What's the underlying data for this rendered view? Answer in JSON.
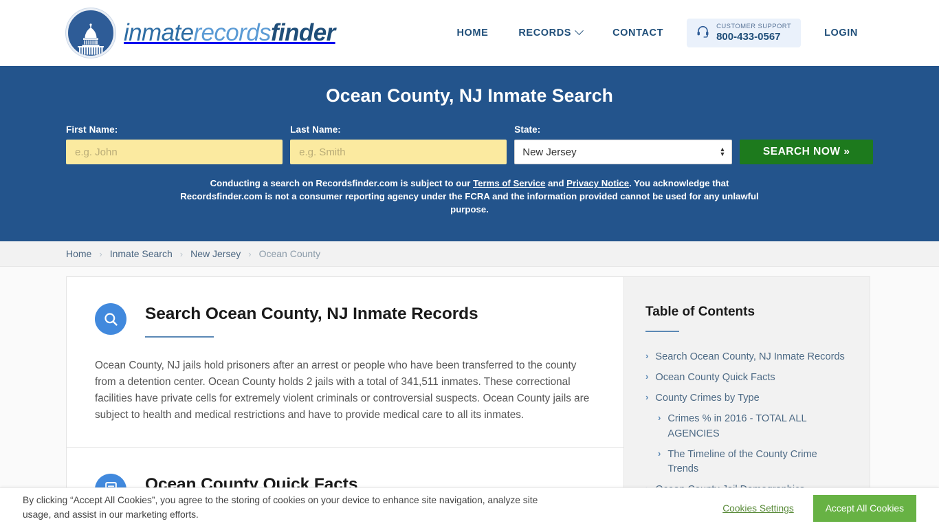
{
  "header": {
    "brand": {
      "part1": "inmate",
      "part2": "records",
      "part3": "finder"
    },
    "nav": [
      {
        "label": "HOME",
        "has_dropdown": false
      },
      {
        "label": "RECORDS",
        "has_dropdown": true
      },
      {
        "label": "CONTACT",
        "has_dropdown": false
      }
    ],
    "support": {
      "label": "CUSTOMER SUPPORT",
      "phone": "800-433-0567",
      "icon": "headset-icon"
    },
    "login_label": "LOGIN"
  },
  "hero": {
    "title": "Ocean County, NJ Inmate Search",
    "first_name": {
      "label": "First Name:",
      "placeholder": "e.g. John",
      "value": ""
    },
    "last_name": {
      "label": "Last Name:",
      "placeholder": "e.g. Smith",
      "value": ""
    },
    "state": {
      "label": "State:",
      "selected": "New Jersey",
      "options": [
        "New Jersey"
      ]
    },
    "search_button": "SEARCH NOW »",
    "disclaimer": {
      "part1": "Conducting a search on Recordsfinder.com is subject to our ",
      "link1": "Terms of Service",
      "part2": " and ",
      "link2": "Privacy Notice",
      "part3": ". You acknowledge that Recordsfinder.com is not a consumer reporting agency under the FCRA and the information provided cannot be used for any unlawful purpose."
    },
    "accent_bg": "#23548c",
    "input_bg": "#fbeaa0",
    "button_bg": "#1d7a1d"
  },
  "breadcrumb": [
    {
      "label": "Home",
      "current": false
    },
    {
      "label": "Inmate Search",
      "current": false
    },
    {
      "label": "New Jersey",
      "current": false
    },
    {
      "label": "Ocean County",
      "current": true
    }
  ],
  "breadcrumb_separator": "›",
  "content": {
    "sections": [
      {
        "icon": "search-icon",
        "title": "Search Ocean County, NJ Inmate Records",
        "body": "Ocean County, NJ jails hold prisoners after an arrest or people who have been transferred to the county from a detention center. Ocean County holds 2 jails with a total of 341,511 inmates. These correctional facilities have private cells for extremely violent criminals or controversial suspects. Ocean County jails are subject to health and medical restrictions and have to provide medical care to all its inmates."
      },
      {
        "icon": "facts-icon",
        "title": "Ocean County Quick Facts",
        "body": ""
      }
    ]
  },
  "sidebar": {
    "title": "Table of Contents",
    "items": [
      {
        "label": "Search Ocean County, NJ Inmate Records",
        "sub": false
      },
      {
        "label": "Ocean County Quick Facts",
        "sub": false
      },
      {
        "label": "County Crimes by Type",
        "sub": false
      },
      {
        "label": "Crimes % in 2016 - TOTAL ALL AGENCIES",
        "sub": true
      },
      {
        "label": "The Timeline of the County Crime Trends",
        "sub": true
      },
      {
        "label": "Ocean County Jail Demographics",
        "sub": false
      }
    ],
    "arrow": "›"
  },
  "cookie_banner": {
    "text": "By clicking “Accept All Cookies”, you agree to the storing of cookies on your device to enhance site navigation, analyze site usage, and assist in our marketing efforts.",
    "settings_label": "Cookies Settings",
    "accept_label": "Accept All Cookies",
    "accept_color": "#67b244"
  }
}
